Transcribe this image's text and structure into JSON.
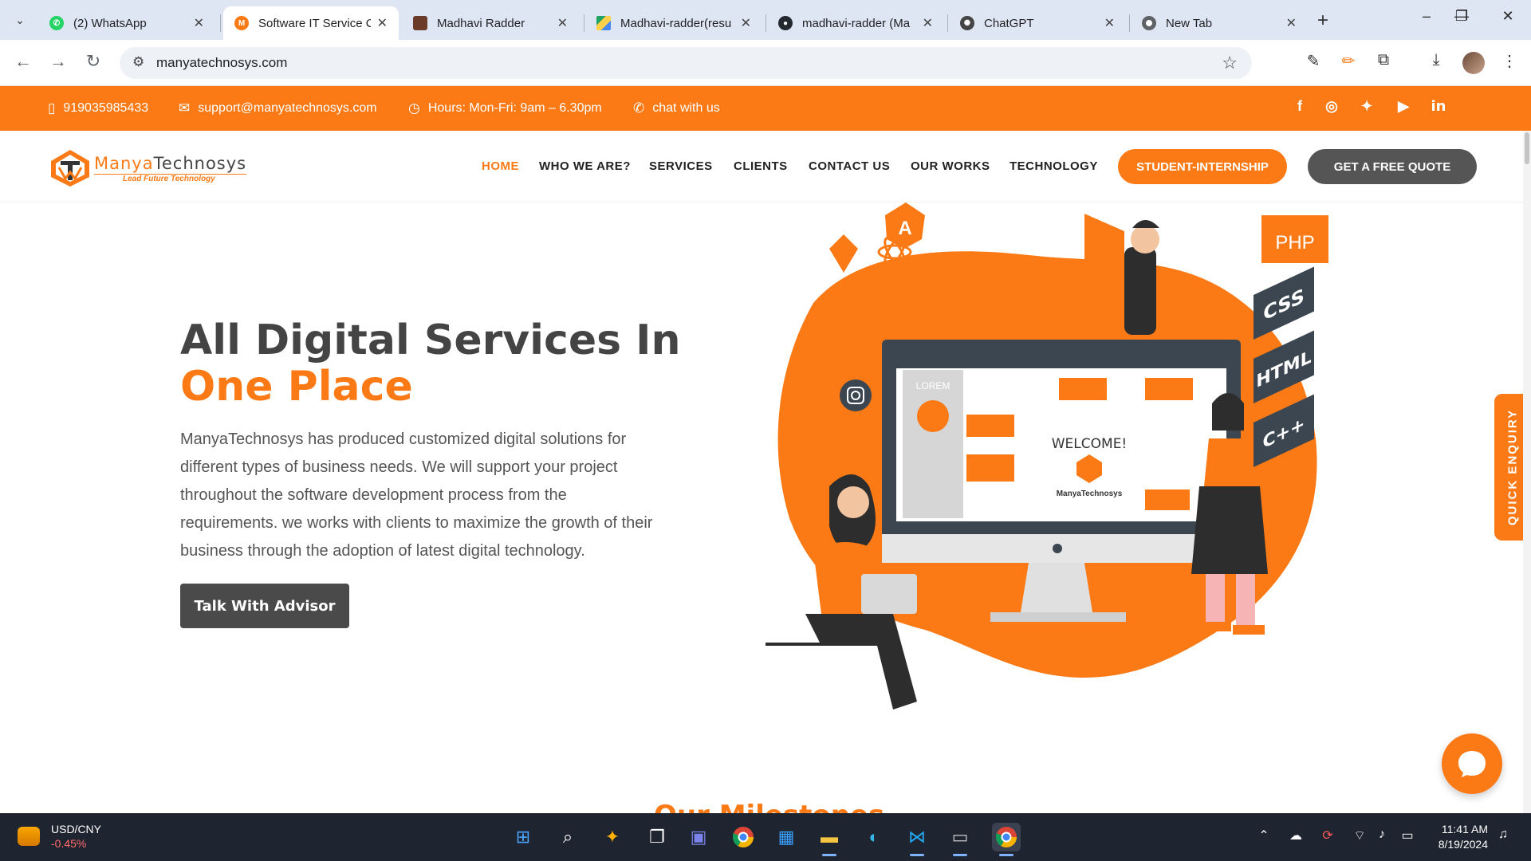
{
  "browser": {
    "tabs": [
      {
        "title": "(2) WhatsApp",
        "icon": "whatsapp-icon",
        "color": "#25D366"
      },
      {
        "title": "Software IT Service C",
        "icon": "manya-icon",
        "color": "#fb7a16"
      },
      {
        "title": "Madhavi Radder",
        "icon": "profile-icon",
        "color": "#6b3b2a"
      },
      {
        "title": "Madhavi-radder(resu",
        "icon": "google-drive-icon",
        "color": "#1fa463"
      },
      {
        "title": "madhavi-radder (Ma",
        "icon": "github-icon",
        "color": "#24292f"
      },
      {
        "title": "ChatGPT",
        "icon": "chatgpt-icon",
        "color": "#444444"
      },
      {
        "title": "New Tab",
        "icon": "chrome-icon",
        "color": "#5f6368"
      }
    ],
    "address": "manyatechnosys.com"
  },
  "topbar": {
    "phone": "919035985433",
    "email": "support@manyatechnosys.com",
    "hours": "Hours: Mon-Fri: 9am – 6.30pm",
    "chat": "chat with us",
    "socials": [
      "facebook-icon",
      "instagram-icon",
      "twitter-icon",
      "youtube-icon",
      "linkedin-icon"
    ]
  },
  "header": {
    "logo_name_a": "Manya",
    "logo_name_b": "Technosys",
    "logo_tagline": "Lead Future Technology",
    "menu": [
      "HOME",
      "WHO WE ARE?",
      "SERVICES",
      "CLIENTS",
      "CONTACT US",
      "OUR WORKS",
      "TECHNOLOGY"
    ],
    "intern_button": "STUDENT-INTERNSHIP",
    "quote_button": "GET A FREE QUOTE"
  },
  "hero": {
    "title_line1": "All Digital Services In",
    "title_line2": "One Place",
    "description": "ManyaTechnosys has produced customized digital solutions for different types of business needs. We will support your project throughout the software development process from the requirements. we works with clients to maximize the growth of their business through the adoption of latest digital technology.",
    "cta": "Talk With Advisor"
  },
  "illustration": {
    "screen_welcome": "WELCOME!",
    "screen_brand": "ManyaTechnosys",
    "screen_lorem": "LOREM",
    "tags": [
      "PHP",
      "CSS",
      "HTML",
      "C++"
    ]
  },
  "quick_enquiry": "QUICK ENQUIRY",
  "section_peek": "Our Milestones",
  "taskbar": {
    "widget_title": "USD/CNY",
    "widget_value": "-0.45%",
    "time": "11:41 AM",
    "date": "8/19/2024"
  },
  "colors": {
    "brand": "#fb7a16",
    "dark": "#4a4a4a"
  }
}
